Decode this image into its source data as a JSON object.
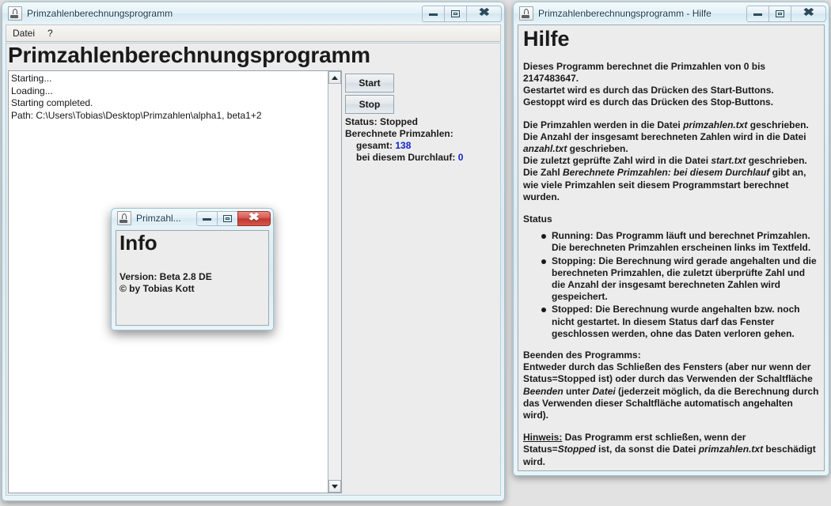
{
  "main_window": {
    "title": "Primzahlenberechnungsprogramm",
    "icon": "java-coffee-cup-icon",
    "controls": {
      "minimize": "minimize-icon",
      "maximize": "maximize-icon",
      "close": "close-icon"
    },
    "menubar": {
      "items": [
        "Datei",
        "?"
      ]
    },
    "heading": "Primzahlenberechnungsprogramm",
    "log_text": "Starting...\nLoading...\nStarting completed.\nPath: C:\\Users\\Tobias\\Desktop\\Primzahlen\\alpha1, beta1+2",
    "buttons": {
      "start": "Start",
      "stop": "Stop"
    },
    "status": {
      "status_label": "Status: Stopped",
      "primes_label": "Berechnete Primzahlen:",
      "total_label": "gesamt:",
      "total_value": "138",
      "run_label": "bei diesem Durchlauf:",
      "run_value": "0",
      "number_color": "#1024c8"
    },
    "scrollbar": {
      "up": "scroll-up-arrow-icon",
      "down": "scroll-down-arrow-icon"
    }
  },
  "info_dialog": {
    "title": "Primzahl...",
    "icon": "java-coffee-cup-icon",
    "controls": {
      "minimize": "minimize-icon",
      "maximize": "maximize-icon",
      "close": "close-icon"
    },
    "heading": "Info",
    "version_line": "Version: Beta 2.8 DE",
    "author_line": "© by Tobias Kott",
    "close_button_color": "#c0392f"
  },
  "help_window": {
    "title": "Primzahlenberechnungsprogramm - Hilfe",
    "icon": "java-coffee-cup-icon",
    "controls": {
      "minimize": "minimize-icon",
      "maximize": "maximize-icon",
      "close": "close-icon"
    },
    "heading": "Hilfe",
    "paragraph_1_line_1": "Dieses Programm berechnet die Primzahlen von 0 bis 2147483647.",
    "paragraph_1_line_2": "Gestartet wird es durch das Drücken des Start-Buttons.",
    "paragraph_1_line_3": "Gestoppt wird es durch das Drücken des Stop-Buttons.",
    "paragraph_2_part_1": "Die Primzahlen werden in die Datei ",
    "paragraph_2_file_1": "primzahlen.txt",
    "paragraph_2_part_2": " geschrieben.",
    "paragraph_2_part_3": "Die Anzahl der insgesamt berechneten Zahlen wird in die Datei ",
    "paragraph_2_file_2": "anzahl.txt",
    "paragraph_2_part_4": " geschrieben.",
    "paragraph_2_part_5": "Die zuletzt geprüfte Zahl wird in die Datei ",
    "paragraph_2_file_3": "start.txt",
    "paragraph_2_part_6": " geschrieben.",
    "paragraph_2_part_7": "Die Zahl ",
    "paragraph_2_italic": "Berechnete Primzahlen: bei diesem Durchlauf",
    "paragraph_2_part_8": " gibt an, wie viele Primzahlen seit diesem Programmstart berechnet wurden.",
    "status_heading": "Status",
    "status_items": [
      "Running: Das Programm läuft und berechnet Primzahlen. Die berechneten Primzahlen erscheinen links im Textfeld.",
      "Stopping: Die Berechnung wird gerade angehalten und die berechneten Primzahlen, die zuletzt überprüfte Zahl und die Anzahl der insgesamt berechneten Zahlen wird gespeichert.",
      "Stopped: Die Berechnung wurde angehalten bzw. noch nicht gestartet. In diesem Status darf das Fenster geschlossen werden, ohne das Daten verloren gehen."
    ],
    "quit_heading": "Beenden des Programms:",
    "quit_part_1": "Entweder durch das Schließen des Fensters (aber nur wenn der Status=Stopped ist) oder durch das Verwenden der Schaltfläche ",
    "quit_italic_1": "Beenden",
    "quit_part_2": " unter ",
    "quit_italic_2": "Datei",
    "quit_part_3": " (jederzeit möglich, da die Berechnung durch das Verwenden dieser Schaltfläche automatisch angehalten wird).",
    "note_label": "Hinweis:",
    "note_part_1": " Das Programm erst schließen, wenn der Status=",
    "note_italic": "Stopped",
    "note_part_2": " ist, da sonst die Datei ",
    "note_file": "primzahlen.txt",
    "note_part_3": " beschädigt wird."
  }
}
